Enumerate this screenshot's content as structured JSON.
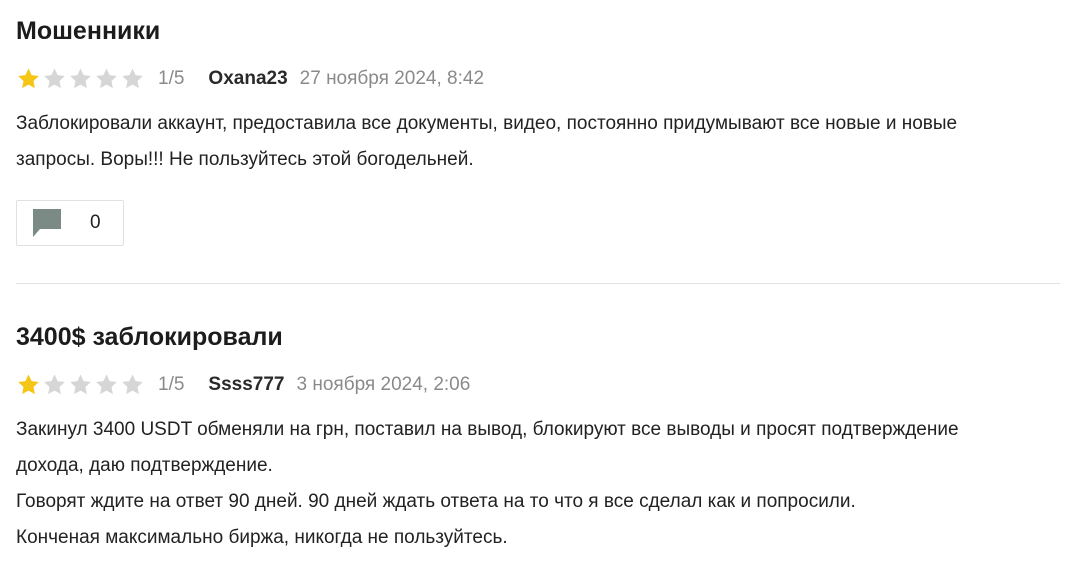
{
  "colors": {
    "star_filled": "#f5c518",
    "star_empty": "#d6d6d6",
    "meta_gray": "#8a8a8a",
    "comment_icon": "#7c8a86"
  },
  "reviews": [
    {
      "title": "Мошенники",
      "rating": 1,
      "rating_text": "1/5",
      "author": "Oxana23",
      "date": "27 ноября 2024, 8:42",
      "body_lines": [
        "Заблокировали аккаунт, предоставила все документы, видео, постоянно придумывают все новые и новые",
        "запросы. Воры!!! Не пользуйтесь этой богодельней."
      ],
      "comment_count": "0"
    },
    {
      "title": "3400$ заблокировали",
      "rating": 1,
      "rating_text": "1/5",
      "author": "Ssss777",
      "date": "3 ноября 2024, 2:06",
      "body_lines": [
        "Закинул 3400 USDT обменяли на грн, поставил на вывод, блокируют все выводы и просят подтверждение",
        "дохода, даю подтверждение.",
        "Говорят ждите на ответ 90 дней. 90 дней ждать ответа на то что я все сделал как и попросили.",
        "Конченая максимально биржа, никогда не пользуйтесь."
      ]
    }
  ]
}
